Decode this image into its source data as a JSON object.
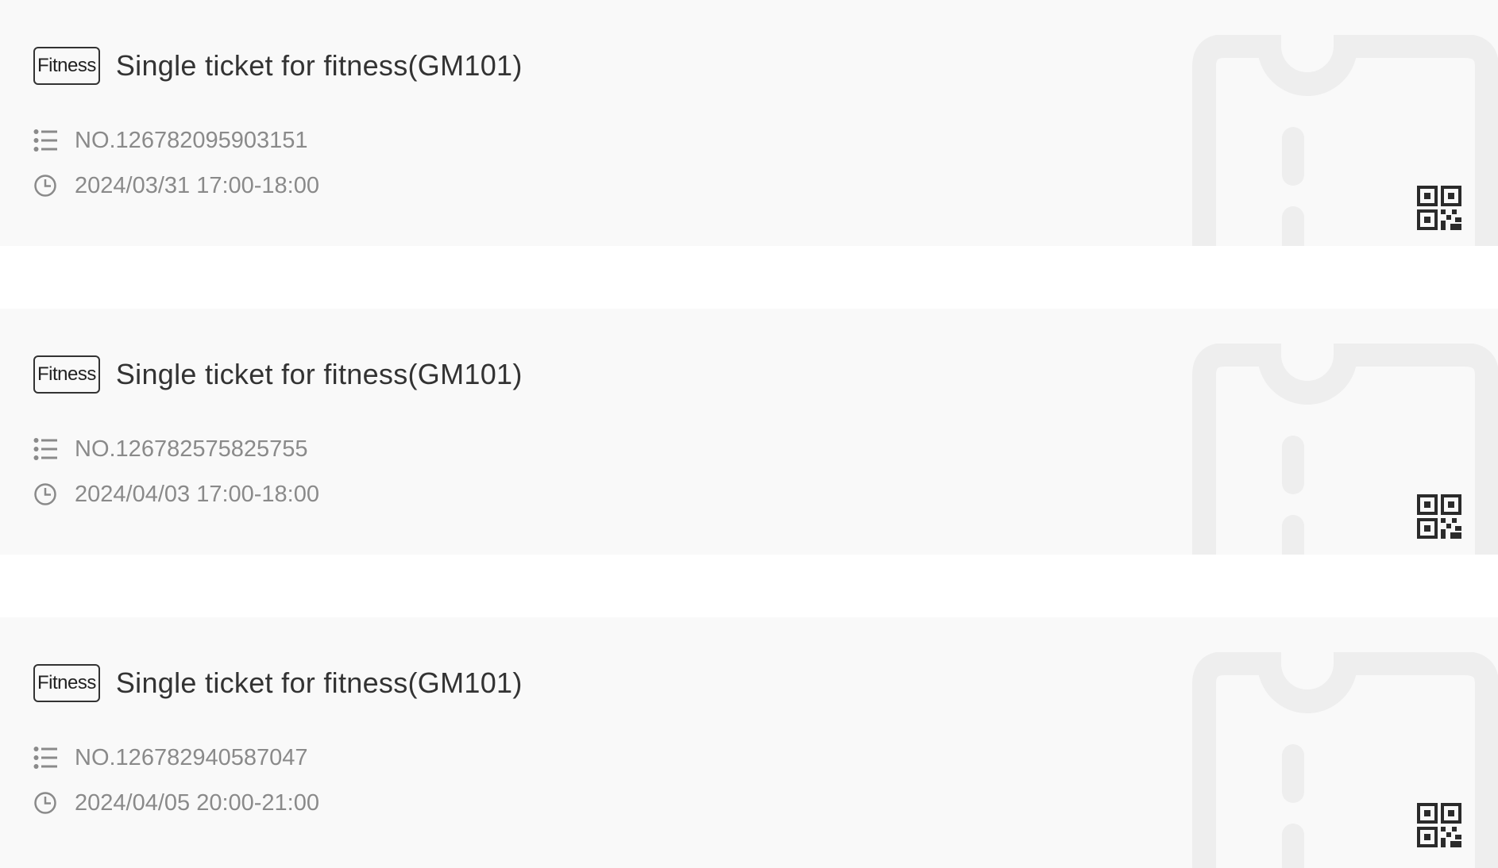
{
  "tickets": [
    {
      "tag": "Fitness",
      "title": "Single ticket for fitness(GM101)",
      "number": "NO.126782095903151",
      "time": "2024/03/31 17:00-18:00"
    },
    {
      "tag": "Fitness",
      "title": "Single ticket for fitness(GM101)",
      "number": "NO.126782575825755",
      "time": "2024/04/03 17:00-18:00"
    },
    {
      "tag": "Fitness",
      "title": "Single ticket for fitness(GM101)",
      "number": "NO.126782940587047",
      "time": "2024/04/05 20:00-21:00"
    }
  ],
  "icons": {
    "number": "list-icon",
    "time": "clock-icon",
    "code": "qr-code-icon",
    "background": "ticket-outline-icon"
  },
  "colors": {
    "card_background": "#f9f9f9",
    "title_text": "#333333",
    "secondary_text": "#8a8a8a",
    "ticket_outline": "#eeeeee"
  }
}
